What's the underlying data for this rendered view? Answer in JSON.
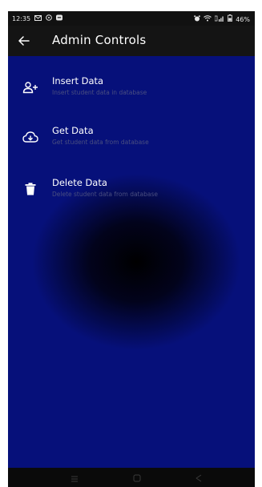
{
  "status_bar": {
    "time": "12:35",
    "left_icons": [
      "mail-icon",
      "message-icon",
      "chat-bubble-icon"
    ],
    "right_icons": [
      "alarm-icon",
      "wifi-icon",
      "signal-icon",
      "battery-icon"
    ],
    "battery_percent": "46%"
  },
  "app_bar": {
    "title": "Admin Controls",
    "back_icon": "arrow-left-icon"
  },
  "menu": {
    "items": [
      {
        "icon": "add-person-icon",
        "title": "Insert Data",
        "subtitle": "Insert student data in database"
      },
      {
        "icon": "cloud-download-icon",
        "title": "Get Data",
        "subtitle": "Get student data from database"
      },
      {
        "icon": "trash-icon",
        "title": "Delete Data",
        "subtitle": "Delete student data from database"
      }
    ]
  },
  "nav_bar": {
    "icons": [
      "menu-lines-icon",
      "home-square-icon",
      "back-triangle-icon"
    ]
  },
  "colors": {
    "background_dark": "#000000",
    "background_blue": "#06107a",
    "subtitle": "#4a4f80",
    "app_bar": "#141414"
  }
}
